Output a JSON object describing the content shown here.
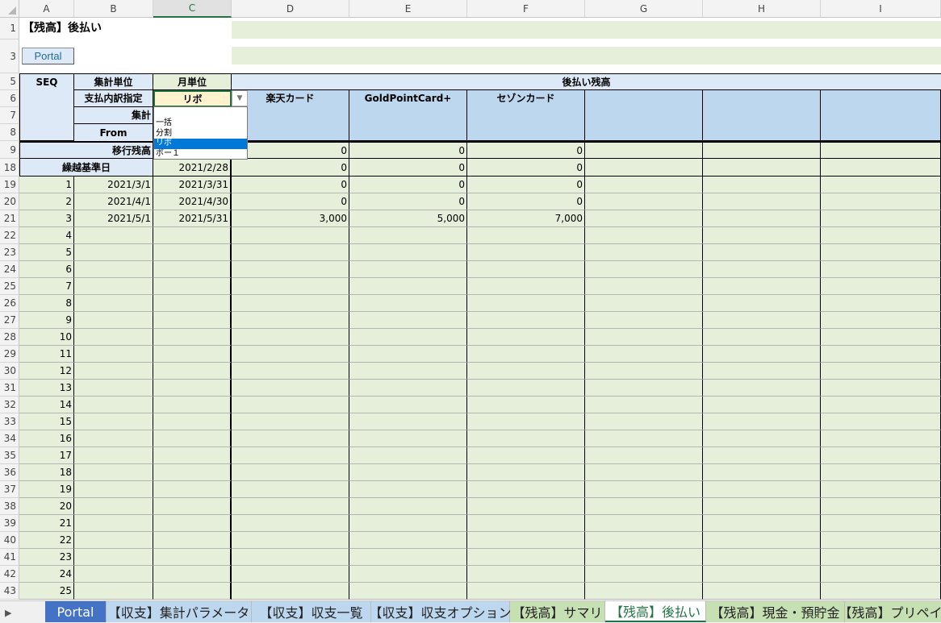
{
  "columns": [
    "A",
    "B",
    "C",
    "D",
    "E",
    "F",
    "G",
    "H",
    "I"
  ],
  "selected_column": "C",
  "sheet": {
    "title": "【残高】後払い",
    "portal_button": "Portal",
    "seq_header": "SEQ",
    "unit_label": "集計単位",
    "unit_value": "月単位",
    "breakdown_label": "支払内訳指定",
    "breakdown_value": "リボ",
    "period_label": "集計",
    "from_label": "From",
    "deferred_header": "後払い残高",
    "cards": [
      "楽天カード",
      "GoldPointCard+",
      "セゾンカード"
    ],
    "transfer_label": "移行残高",
    "transfer_values": [
      "0",
      "0",
      "0"
    ],
    "carry_label": "繰越基準日",
    "carry_date": "2021/2/28",
    "carry_values": [
      "0",
      "0",
      "0"
    ]
  },
  "dropdown": {
    "options": [
      "一括",
      "分割",
      "リボ",
      "ボー１"
    ],
    "selected": 2
  },
  "rows": [
    {
      "row": "19",
      "seq": "1",
      "from": "2021/3/1",
      "to": "2021/3/31",
      "v1": "0",
      "v2": "0",
      "v3": "0"
    },
    {
      "row": "20",
      "seq": "2",
      "from": "2021/4/1",
      "to": "2021/4/30",
      "v1": "0",
      "v2": "0",
      "v3": "0"
    },
    {
      "row": "21",
      "seq": "3",
      "from": "2021/5/1",
      "to": "2021/5/31",
      "v1": "3,000",
      "v2": "5,000",
      "v3": "7,000"
    },
    {
      "row": "22",
      "seq": "4"
    },
    {
      "row": "23",
      "seq": "5"
    },
    {
      "row": "24",
      "seq": "6"
    },
    {
      "row": "25",
      "seq": "7"
    },
    {
      "row": "26",
      "seq": "8"
    },
    {
      "row": "27",
      "seq": "9"
    },
    {
      "row": "28",
      "seq": "10"
    },
    {
      "row": "29",
      "seq": "11"
    },
    {
      "row": "30",
      "seq": "12"
    },
    {
      "row": "31",
      "seq": "13"
    },
    {
      "row": "32",
      "seq": "14"
    },
    {
      "row": "33",
      "seq": "15"
    },
    {
      "row": "34",
      "seq": "16"
    },
    {
      "row": "35",
      "seq": "17"
    },
    {
      "row": "36",
      "seq": "18"
    },
    {
      "row": "37",
      "seq": "19"
    },
    {
      "row": "38",
      "seq": "20"
    },
    {
      "row": "39",
      "seq": "21"
    },
    {
      "row": "40",
      "seq": "22"
    },
    {
      "row": "41",
      "seq": "23"
    },
    {
      "row": "42",
      "seq": "24"
    },
    {
      "row": "43",
      "seq": "25"
    }
  ],
  "top_row_labels": [
    "1",
    "3",
    "5",
    "6",
    "7",
    "8",
    "9",
    "18"
  ],
  "tabs": [
    {
      "label": "Portal",
      "style": "portal"
    },
    {
      "label": "【収支】集計パラメータ",
      "style": "blue"
    },
    {
      "label": "【収支】収支一覧",
      "style": "blue"
    },
    {
      "label": "【収支】収支オプション",
      "style": "blue"
    },
    {
      "label": "【残高】サマリ",
      "style": "green"
    },
    {
      "label": "【残高】後払い",
      "style": "active"
    },
    {
      "label": "【残高】現金・預貯金",
      "style": "green"
    },
    {
      "label": "【残高】プリペイド",
      "style": "green"
    }
  ],
  "tab_nav_icon": "scroll-right-icon",
  "colors": {
    "grid_green": "#e6efda",
    "header_blue": "#bdd7ee",
    "pale_blue": "#dde9f6",
    "excel_green": "#217346",
    "selection_blue": "#0078d7",
    "portal_tab": "#4472c4"
  }
}
